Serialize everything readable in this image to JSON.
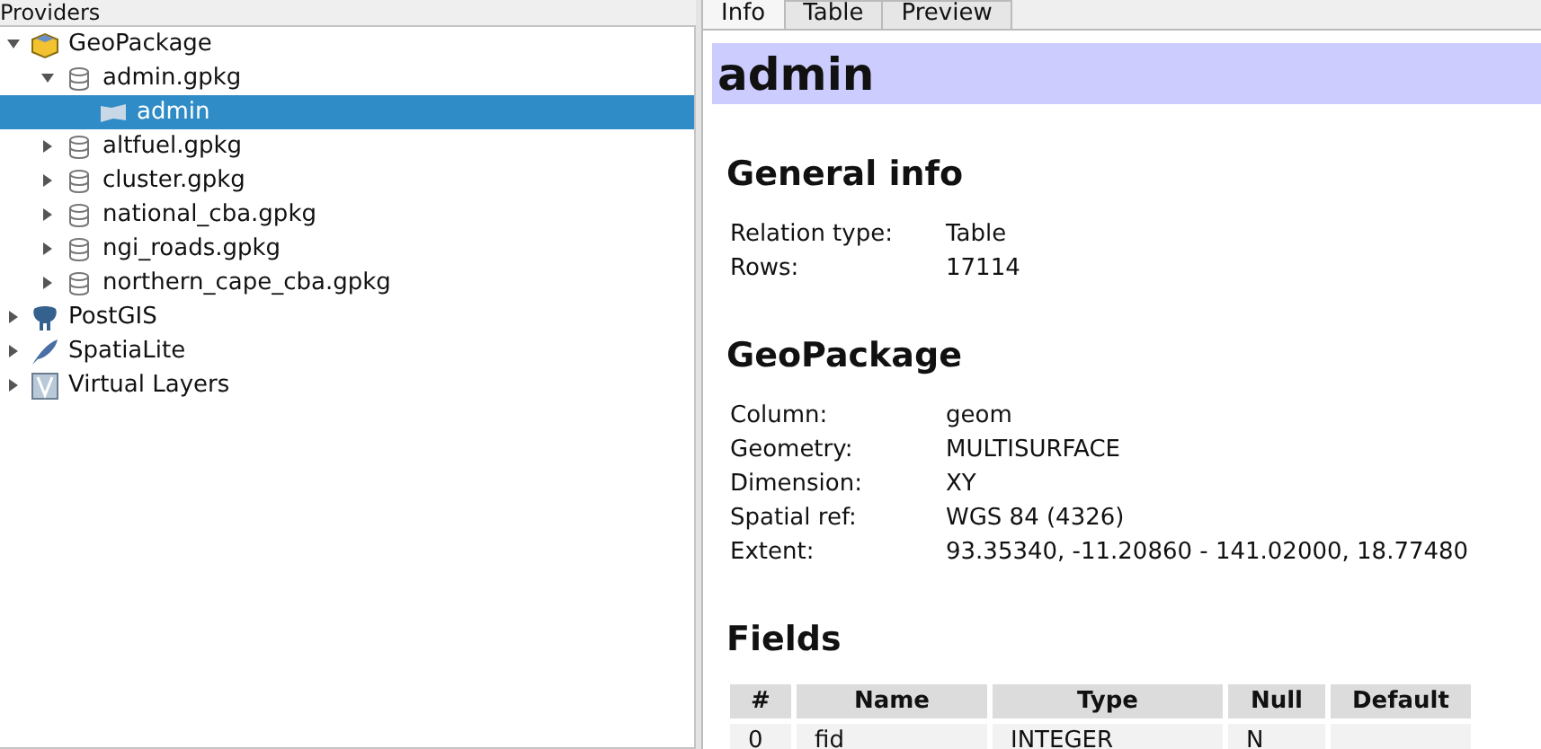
{
  "panel_title": "Providers",
  "tree": [
    {
      "label": "GeoPackage",
      "kind": "geopackage",
      "expanded": true,
      "selected": false,
      "children": [
        {
          "label": "admin.gpkg",
          "kind": "database",
          "expanded": true,
          "selected": false,
          "children": [
            {
              "label": "admin",
              "kind": "layer",
              "selected": true
            }
          ]
        },
        {
          "label": "altfuel.gpkg",
          "kind": "database",
          "expanded": false,
          "selected": false
        },
        {
          "label": "cluster.gpkg",
          "kind": "database",
          "expanded": false,
          "selected": false
        },
        {
          "label": "national_cba.gpkg",
          "kind": "database",
          "expanded": false,
          "selected": false
        },
        {
          "label": "ngi_roads.gpkg",
          "kind": "database",
          "expanded": false,
          "selected": false
        },
        {
          "label": "northern_cape_cba.gpkg",
          "kind": "database",
          "expanded": false,
          "selected": false
        }
      ]
    },
    {
      "label": "PostGIS",
      "kind": "postgis",
      "expanded": false,
      "selected": false
    },
    {
      "label": "SpatiaLite",
      "kind": "spatialite",
      "expanded": false,
      "selected": false
    },
    {
      "label": "Virtual Layers",
      "kind": "virtual",
      "expanded": false,
      "selected": false
    }
  ],
  "tabs": [
    {
      "label": "Info",
      "selected": true
    },
    {
      "label": "Table",
      "selected": false
    },
    {
      "label": "Preview",
      "selected": false
    }
  ],
  "title": "admin",
  "sections": [
    {
      "heading": "General info",
      "rows": [
        [
          "Relation type:",
          "Table"
        ],
        [
          "Rows:",
          "17114"
        ]
      ]
    },
    {
      "heading": "GeoPackage",
      "rows": [
        [
          "Column:",
          "geom"
        ],
        [
          "Geometry:",
          "MULTISURFACE"
        ],
        [
          "Dimension:",
          "XY"
        ],
        [
          "Spatial ref:",
          "WGS 84 (4326)"
        ],
        [
          "Extent:",
          "93.35340, -11.20860 - 141.02000, 18.77480"
        ]
      ]
    }
  ],
  "fields": {
    "heading": "Fields",
    "columns": [
      "#",
      "Name",
      "Type",
      "Null",
      "Default"
    ],
    "rows": [
      [
        "0",
        "fid",
        "INTEGER",
        "N",
        ""
      ]
    ]
  }
}
